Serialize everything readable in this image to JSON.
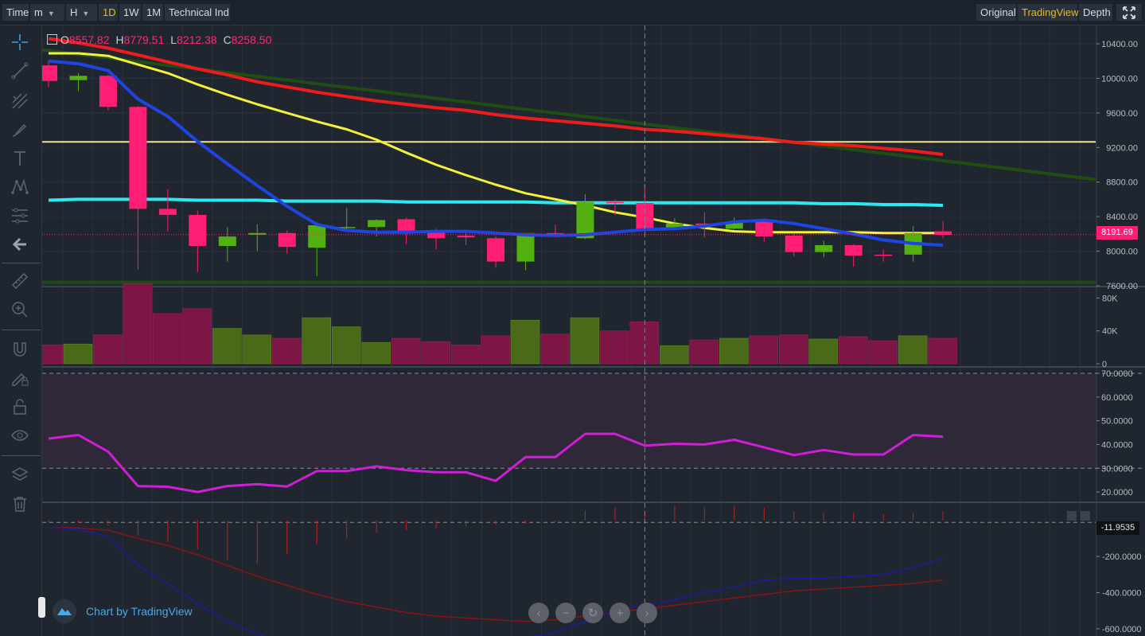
{
  "toolbar": {
    "time_label": "Time",
    "minute_label": "m",
    "hour_label": "H",
    "day_label": "1D",
    "week_label": "1W",
    "month_label": "1M",
    "indicators_label": "Technical Ind",
    "original_label": "Original",
    "tradingview_label": "TradingView",
    "depth_label": "Depth",
    "active_interval": "1D",
    "active_view": "TradingView"
  },
  "left_tools": [
    {
      "name": "crosshair-icon"
    },
    {
      "name": "trend-line-icon"
    },
    {
      "name": "pitchfork-icon"
    },
    {
      "name": "brush-icon"
    },
    {
      "name": "text-icon"
    },
    {
      "name": "pattern-icon"
    },
    {
      "name": "fib-icon"
    },
    {
      "name": "back-arrow-icon"
    },
    {
      "name": "ruler-icon"
    },
    {
      "name": "zoom-in-icon"
    },
    {
      "name": "magnet-icon"
    },
    {
      "name": "lock-drawing-icon"
    },
    {
      "name": "lock-icon"
    },
    {
      "name": "eye-icon"
    },
    {
      "name": "layers-icon"
    },
    {
      "name": "trash-icon"
    }
  ],
  "legend": {
    "o_key": "O",
    "o_val": "8557.82",
    "h_key": "H",
    "h_val": "8779.51",
    "l_key": "L",
    "l_val": "8212.38",
    "c_key": "C",
    "c_val": "8258.50"
  },
  "price_axis_ticks": [
    "10400.00",
    "10000.00",
    "9600.00",
    "9200.00",
    "8800.00",
    "8400.00",
    "8000.00",
    "7600.00"
  ],
  "volume_axis_ticks": [
    "80K",
    "40K",
    "0"
  ],
  "rsi_axis_ticks": [
    "70.0000",
    "60.0000",
    "50.0000",
    "40.0000",
    "30.0000",
    "20.0000"
  ],
  "macd_axis_ticks": [
    "-200.0000",
    "-400.0000",
    "-600.0000"
  ],
  "current_price_tag": "8191.69",
  "macd_value_tag": "-11.9535",
  "brand_text": "Chart by TradingView",
  "colors": {
    "up": "#53b011",
    "down": "#ff1e73",
    "up_volume": "#4a6a1a",
    "down_volume": "#7d1645",
    "ma_blue": "#1f45e0",
    "ma_yellow": "#f2f23a",
    "ma_red": "#ee1c1c",
    "ma_darkgreen": "#1f4d12",
    "ma_cyan": "#2ee8f0",
    "rsi": "#d01ed6",
    "macd_line": "#1c1ca0",
    "signal_line": "#8a1414",
    "hist": "#c81e1e"
  },
  "chart_data": {
    "type": "candlestick",
    "interval": "1D",
    "ylim": [
      7600,
      10520
    ],
    "candles": [
      {
        "o": 10150,
        "h": 10200,
        "l": 9900,
        "c": 9970
      },
      {
        "o": 9980,
        "h": 10060,
        "l": 9850,
        "c": 10030
      },
      {
        "o": 10030,
        "h": 10040,
        "l": 9630,
        "c": 9670
      },
      {
        "o": 9670,
        "h": 9680,
        "l": 7790,
        "c": 8490
      },
      {
        "o": 8490,
        "h": 8720,
        "l": 8230,
        "c": 8420
      },
      {
        "o": 8420,
        "h": 8470,
        "l": 7760,
        "c": 8060
      },
      {
        "o": 8060,
        "h": 8280,
        "l": 7880,
        "c": 8170
      },
      {
        "o": 8190,
        "h": 8310,
        "l": 8000,
        "c": 8210
      },
      {
        "o": 8210,
        "h": 8240,
        "l": 7970,
        "c": 8050
      },
      {
        "o": 8040,
        "h": 8340,
        "l": 7710,
        "c": 8300
      },
      {
        "o": 8280,
        "h": 8500,
        "l": 8250,
        "c": 8280
      },
      {
        "o": 8280,
        "h": 8370,
        "l": 8170,
        "c": 8360
      },
      {
        "o": 8370,
        "h": 8390,
        "l": 8080,
        "c": 8230
      },
      {
        "o": 8230,
        "h": 8260,
        "l": 8020,
        "c": 8150
      },
      {
        "o": 8180,
        "h": 8230,
        "l": 8070,
        "c": 8160
      },
      {
        "o": 8150,
        "h": 8170,
        "l": 7810,
        "c": 7880
      },
      {
        "o": 7880,
        "h": 8210,
        "l": 7780,
        "c": 8210
      },
      {
        "o": 8210,
        "h": 8310,
        "l": 8160,
        "c": 8180
      },
      {
        "o": 8150,
        "h": 8660,
        "l": 8140,
        "c": 8570
      },
      {
        "o": 8570,
        "h": 8600,
        "l": 8420,
        "c": 8560
      },
      {
        "o": 8557.82,
        "h": 8779.51,
        "l": 8212.38,
        "c": 8258.5
      },
      {
        "o": 8270,
        "h": 8380,
        "l": 8270,
        "c": 8320
      },
      {
        "o": 8320,
        "h": 8450,
        "l": 8160,
        "c": 8300
      },
      {
        "o": 8260,
        "h": 8390,
        "l": 8250,
        "c": 8340
      },
      {
        "o": 8350,
        "h": 8380,
        "l": 8110,
        "c": 8170
      },
      {
        "o": 8180,
        "h": 8210,
        "l": 7940,
        "c": 7990
      },
      {
        "o": 7990,
        "h": 8120,
        "l": 7930,
        "c": 8070
      },
      {
        "o": 8070,
        "h": 8080,
        "l": 7820,
        "c": 7950
      },
      {
        "o": 7960,
        "h": 8020,
        "l": 7880,
        "c": 7950
      },
      {
        "o": 7960,
        "h": 8290,
        "l": 7880,
        "c": 8210
      },
      {
        "o": 8230,
        "h": 8350,
        "l": 8150,
        "c": 8190
      }
    ],
    "volume": [
      23000,
      24000,
      35000,
      97000,
      61000,
      67000,
      43000,
      35000,
      31000,
      56000,
      45000,
      26000,
      31000,
      27000,
      23000,
      34000,
      53000,
      36000,
      56000,
      40000,
      51000,
      22000,
      29000,
      31000,
      34000,
      35000,
      30000,
      33000,
      28000,
      34000,
      31000
    ],
    "volume_ylim": [
      0,
      90000
    ],
    "ma_blue": [
      10200,
      10170,
      10090,
      9760,
      9560,
      9270,
      9010,
      8760,
      8520,
      8310,
      8240,
      8220,
      8220,
      8230,
      8230,
      8210,
      8190,
      8180,
      8190,
      8220,
      8250,
      8260,
      8290,
      8340,
      8360,
      8320,
      8260,
      8200,
      8130,
      8090,
      8070
    ],
    "ma_yellow": [
      10290,
      10290,
      10260,
      10160,
      10060,
      9930,
      9810,
      9700,
      9600,
      9500,
      9410,
      9290,
      9140,
      9000,
      8880,
      8770,
      8670,
      8600,
      8530,
      8450,
      8390,
      8320,
      8270,
      8230,
      8220,
      8220,
      8220,
      8220,
      8210,
      8210,
      8210
    ],
    "ma_red": [
      10460,
      10410,
      10350,
      10270,
      10190,
      10110,
      10040,
      9960,
      9900,
      9840,
      9790,
      9740,
      9700,
      9660,
      9630,
      9580,
      9540,
      9510,
      9480,
      9450,
      9410,
      9390,
      9360,
      9330,
      9300,
      9260,
      9240,
      9220,
      9190,
      9160,
      9120
    ],
    "ma_darkgreen_line": {
      "start": 10330,
      "end": 8830
    },
    "ma_cyan": [
      8590,
      8600,
      8600,
      8600,
      8600,
      8590,
      8590,
      8590,
      8580,
      8580,
      8580,
      8580,
      8570,
      8570,
      8570,
      8570,
      8570,
      8560,
      8560,
      8560,
      8560,
      8560,
      8560,
      8560,
      8560,
      8560,
      8550,
      8550,
      8540,
      8540,
      8530
    ],
    "horizontal_lines": [
      {
        "price": 9265,
        "color": "#f6e58d"
      },
      {
        "price": 7640,
        "color": "#1f4d12"
      }
    ],
    "current_price": 8191.69,
    "rsi": [
      42.5,
      44,
      37,
      22.5,
      22.2,
      20,
      22.5,
      23.3,
      22.3,
      28.8,
      28.8,
      30.8,
      29.2,
      28.3,
      28.3,
      24.7,
      34.7,
      34.7,
      44.5,
      44.5,
      39.5,
      40.3,
      40,
      42,
      38.8,
      35.5,
      37.7,
      35.8,
      35.8,
      44,
      43.3
    ],
    "rsi_ylim": [
      16,
      72
    ],
    "rsi_bands": [
      70,
      30
    ],
    "macd": [
      -40,
      -50,
      -90,
      -250,
      -350,
      -460,
      -560,
      -630,
      -680,
      -710,
      -720,
      -720,
      -700,
      -690,
      -680,
      -670,
      -650,
      -620,
      -560,
      -500,
      -470,
      -440,
      -400,
      -370,
      -330,
      -320,
      -320,
      -310,
      -300,
      -260,
      -210
    ],
    "signal": [
      -40,
      -42,
      -55,
      -100,
      -140,
      -190,
      -250,
      -310,
      -360,
      -410,
      -450,
      -480,
      -510,
      -530,
      -540,
      -550,
      -560,
      -550,
      -530,
      -510,
      -490,
      -470,
      -450,
      -430,
      -410,
      -390,
      -380,
      -370,
      -360,
      -350,
      -330
    ],
    "histogram": [
      -12,
      -15,
      -30,
      -85,
      -120,
      -160,
      -220,
      -240,
      -185,
      -130,
      -100,
      -70,
      -55,
      -45,
      -35,
      -25,
      -20,
      -10,
      55,
      70,
      50,
      80,
      75,
      80,
      70,
      50,
      40,
      40,
      35,
      40,
      50
    ],
    "macd_ylim": [
      -640,
      95
    ],
    "macd_current": -11.9535
  }
}
